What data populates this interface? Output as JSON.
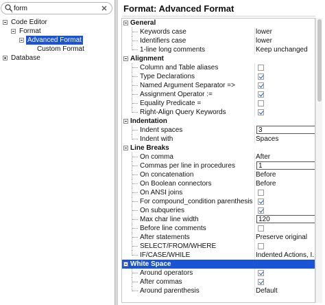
{
  "search": {
    "value": "form",
    "placeholder": ""
  },
  "tree": {
    "code_editor": "Code Editor",
    "format": "Format",
    "advanced_format": "Advanced Format",
    "custom_format": "Custom Format",
    "database": "Database"
  },
  "panel": {
    "title": "Format: Advanced Format"
  },
  "sections": {
    "general": "General",
    "alignment": "Alignment",
    "indentation": "Indentation",
    "line_breaks": "Line Breaks",
    "white_space": "White Space"
  },
  "general": {
    "keywords_case": {
      "label": "Keywords case",
      "value": "lower"
    },
    "identifiers_case": {
      "label": "Identifiers case",
      "value": "lower"
    },
    "one_line_comments": {
      "label": "1-line long comments",
      "value": "Keep unchanged"
    }
  },
  "alignment": {
    "column_table_aliases": {
      "label": "Column and Table aliases",
      "checked": false
    },
    "type_declarations": {
      "label": "Type Declarations",
      "checked": true
    },
    "named_arg_sep": {
      "label": "Named Argument Separator =>",
      "checked": true
    },
    "assignment_op": {
      "label": "Assignment Operator :=",
      "checked": true
    },
    "equality_pred": {
      "label": "Equality Predicate =",
      "checked": false
    },
    "right_align_kw": {
      "label": "Right-Align Query Keywords",
      "checked": true
    }
  },
  "indentation": {
    "indent_spaces": {
      "label": "Indent spaces",
      "value": "3"
    },
    "indent_with": {
      "label": "Indent with",
      "value": "Spaces"
    }
  },
  "line_breaks": {
    "on_comma": {
      "label": "On comma",
      "value": "After"
    },
    "commas_per_line": {
      "label": "Commas per line in procedures",
      "value": "1"
    },
    "on_concatenation": {
      "label": "On concatenation",
      "value": "Before"
    },
    "on_boolean": {
      "label": "On Boolean connectors",
      "value": "Before"
    },
    "on_ansi_joins": {
      "label": "On ANSI joins",
      "checked": false
    },
    "compound_condition": {
      "label": "For compound_condition parenthesis",
      "checked": true
    },
    "on_subqueries": {
      "label": "On subqueries",
      "checked": true
    },
    "max_char_width": {
      "label": "Max char line width",
      "value": "120"
    },
    "before_line_comments": {
      "label": "Before line comments",
      "checked": false
    },
    "after_statements": {
      "label": "After statements",
      "value": "Preserve original"
    },
    "select_from_where": {
      "label": "SELECT/FROM/WHERE",
      "checked": false
    },
    "if_case_while": {
      "label": "IF/CASE/WHILE",
      "value": "Indented Actions, I..."
    }
  },
  "white_space": {
    "around_operators": {
      "label": "Around operators",
      "checked": true
    },
    "after_commas": {
      "label": "After commas",
      "checked": true
    },
    "around_parenthesis": {
      "label": "Around parenthesis",
      "value": "Default"
    }
  },
  "colors": {
    "selection": "#1a53d4",
    "check": "#1a53d4"
  }
}
